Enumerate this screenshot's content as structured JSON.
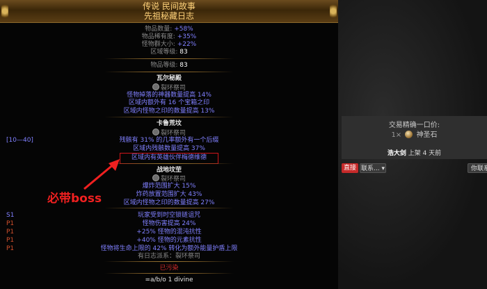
{
  "item": {
    "rarity_line": "传说 民间故事",
    "name": "先祖秘藏日志",
    "props": [
      {
        "label": "物品数量:",
        "value": "+58%"
      },
      {
        "label": "物品稀有度:",
        "value": "+35%"
      },
      {
        "label": "怪物群大小:",
        "value": "+22%"
      },
      {
        "label": "区域等级:",
        "value": "83"
      }
    ],
    "item_level": {
      "label": "物品等级:",
      "value": "83"
    },
    "sections": [
      {
        "title": "瓦尔秘殿",
        "faction": "裂环祭司",
        "mods": [
          "怪物掉落的神器数量提高 14%",
          "区域内额外有 16 个宝箱之印",
          "区域内怪物之印的数量提高 13%"
        ]
      },
      {
        "title": "卡鲁荒坟",
        "faction": "裂环祭司",
        "mods": [
          "残骸有 31% 的几率额外有一个后缀",
          "区域内残骸数量提高 37%",
          "区域内有英雄伙伴梅德维德"
        ]
      },
      {
        "title": "战地坟茔",
        "faction": "裂环祭司",
        "mods": [
          "爆炸范围扩大 15%",
          "炸药放置范围扩大 43%",
          "区域内怪物之印的数量提高 27%"
        ]
      }
    ],
    "range_tag": "[10—40]",
    "explicit_mods": [
      {
        "tag": "S1",
        "text": "玩家受到时空锁链诅咒"
      },
      {
        "tag": "P1",
        "text": "怪物伤害提高 24%"
      },
      {
        "tag": "P1",
        "text": "+25% 怪物的混沌抗性"
      },
      {
        "tag": "P1",
        "text": "+40% 怪物的元素抗性"
      },
      {
        "tag": "P1",
        "text": "怪物将生命上限的 42% 转化为额外能量护盾上限"
      }
    ],
    "journal_faction": "有日志派系：裂环祭司",
    "corrupted": "已污染",
    "note": "=a/b/o 1 divine"
  },
  "annotation": {
    "text": "必带boss"
  },
  "trade": {
    "label": "交易精确一口价:",
    "qty": "1×",
    "currency": "神圣石",
    "seller": "浩大剑",
    "listed": "上架 4 天前",
    "buy_button": "直接",
    "contact_button": "联系...",
    "whisper_button": "你联系"
  },
  "colors": {
    "accent_red": "#d0161a",
    "mod_blue": "#8080ff",
    "header_gold": "#ffd27a"
  }
}
